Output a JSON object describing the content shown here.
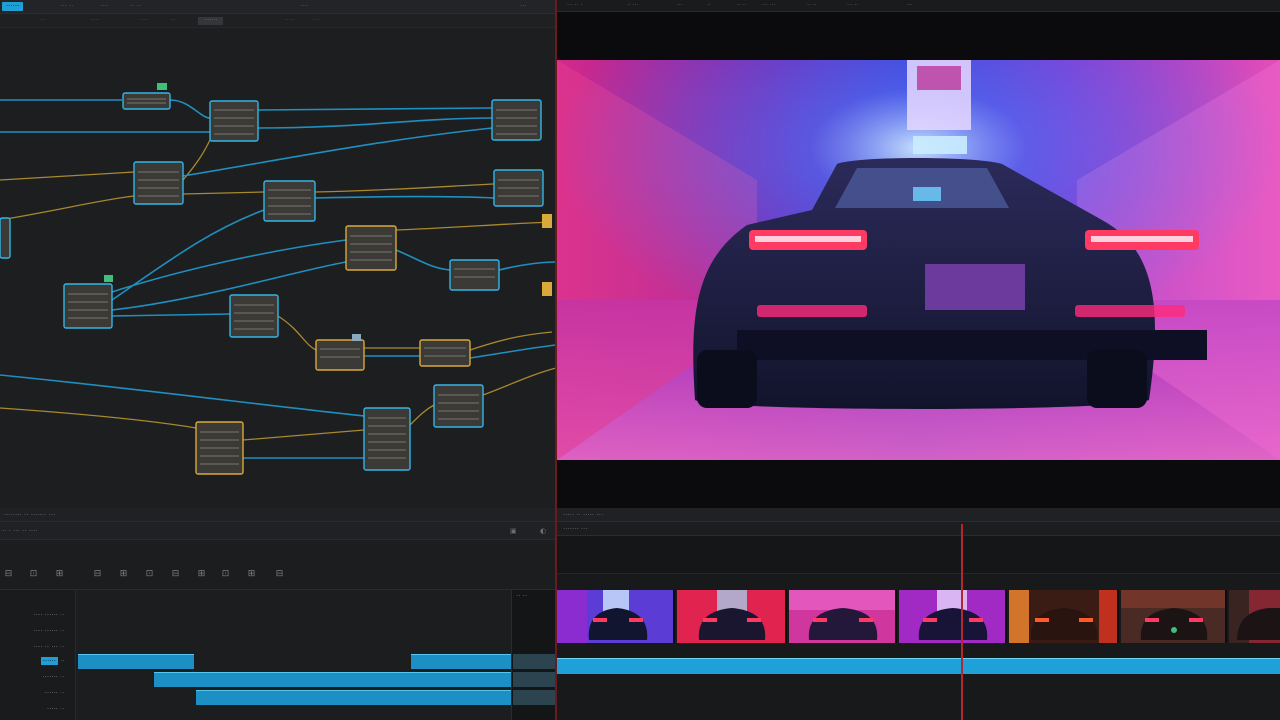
{
  "node_editor": {
    "top_tabs": [
      {
        "label": "······",
        "active": true
      },
      {
        "label": "··· ··"
      },
      {
        "label": "····"
      },
      {
        "label": "·· ··"
      },
      {
        "label": "····"
      },
      {
        "label": "···"
      }
    ],
    "sub_tabs": [
      {
        "label": "···"
      },
      {
        "label": "·····"
      },
      {
        "label": "····"
      },
      {
        "label": "···"
      },
      {
        "label": "·······",
        "active": true
      },
      {
        "label": "·····"
      },
      {
        "label": "····"
      }
    ],
    "status_text": "········ ·· ·······  ···"
  },
  "viewer": {
    "top_items": [
      "··· ·· ·",
      "·· ···",
      "···",
      "··",
      "·· ··",
      "··· ···",
      "·· ··",
      "··· ··",
      "···"
    ]
  },
  "inspector": {
    "header_title": "·· · ···  ·· ····",
    "tool_icons": [
      "keyframe-icon",
      "ease-in-icon",
      "ease-out-icon",
      "bezier-icon",
      "linear-icon",
      "hold-icon",
      "snap-icon",
      "loop-icon",
      "fit-icon",
      "zoom-icon",
      "frame-icon"
    ],
    "tracks": [
      {
        "label": "···· ······",
        "num": "··"
      },
      {
        "label": "···· ······",
        "num": "··"
      },
      {
        "label": "···· ·· ···",
        "num": "··"
      },
      {
        "label": "······",
        "num": "··",
        "active": true
      },
      {
        "label": "·······",
        "num": "··"
      },
      {
        "label": "······",
        "num": "··"
      },
      {
        "label": "·····",
        "num": "··"
      }
    ],
    "right_header": "·· ··"
  },
  "timeline": {
    "bar1_title": "····· ·· ····· ···",
    "bar2_title": "······· ···",
    "accent_color": "#1ea1d8",
    "playhead_color": "#b5262d"
  }
}
